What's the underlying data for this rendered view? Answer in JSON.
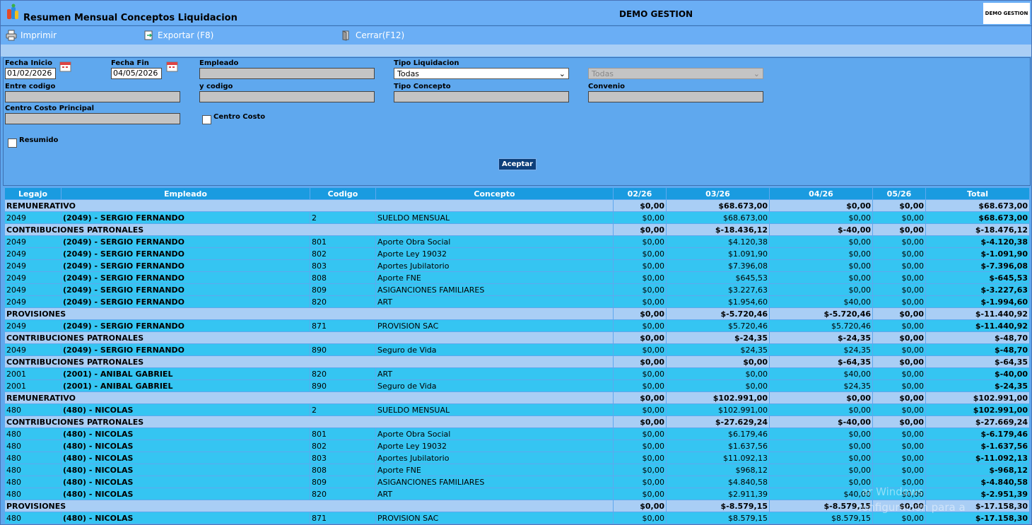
{
  "header": {
    "title": "Resumen Mensual Conceptos Liquidacion",
    "company": "DEMO GESTION",
    "brand_text": "DEMO GESTION"
  },
  "toolbar": {
    "print_label": "Imprimir",
    "export_label": "Exportar (F8)",
    "close_label": "Cerrar(F12)"
  },
  "filters": {
    "fecha_inicio_label": "Fecha Inicio",
    "fecha_inicio_value": "01/02/2026",
    "fecha_fin_label": "Fecha Fin",
    "fecha_fin_value": "04/05/2026",
    "empleado_label": "Empleado",
    "empleado_value": "",
    "tipo_liquidacion_label": "Tipo Liquidacion",
    "tipo_liquidacion_value": "Todas",
    "sub_tipo_value": "Todas",
    "entre_codigo_label": "Entre codigo",
    "y_codigo_label": "y codigo",
    "tipo_concepto_label": "Tipo Concepto",
    "convenio_label": "Convenio",
    "centro_costo_principal_label": "Centro Costo Principal",
    "centro_costo_label": "Centro Costo",
    "resumido_label": "Resumido",
    "accept_label": "Aceptar"
  },
  "table": {
    "headers": [
      "Legajo",
      "Empleado",
      "Codigo",
      "Concepto",
      "02/26",
      "03/26",
      "04/26",
      "05/26",
      "Total"
    ],
    "rows": [
      {
        "type": "group",
        "label": "REMUNERATIVO",
        "vals": [
          "$0,00",
          "$68.673,00",
          "$0,00",
          "$0,00",
          "$68.673,00"
        ]
      },
      {
        "type": "detail",
        "legajo": "2049",
        "empleado": "(2049) - SERGIO FERNANDO",
        "codigo": "2",
        "concepto": "SUELDO MENSUAL",
        "vals": [
          "$0,00",
          "$68.673,00",
          "$0,00",
          "$0,00",
          "$68.673,00"
        ]
      },
      {
        "type": "group",
        "label": "CONTRIBUCIONES PATRONALES",
        "vals": [
          "$0,00",
          "$-18.436,12",
          "$-40,00",
          "$0,00",
          "$-18.476,12"
        ]
      },
      {
        "type": "detail",
        "legajo": "2049",
        "empleado": "(2049) - SERGIO FERNANDO",
        "codigo": "801",
        "concepto": "Aporte Obra Social",
        "vals": [
          "$0,00",
          "$4.120,38",
          "$0,00",
          "$0,00",
          "$-4.120,38"
        ]
      },
      {
        "type": "detail",
        "legajo": "2049",
        "empleado": "(2049) - SERGIO FERNANDO",
        "codigo": "802",
        "concepto": "Aporte Ley 19032",
        "vals": [
          "$0,00",
          "$1.091,90",
          "$0,00",
          "$0,00",
          "$-1.091,90"
        ]
      },
      {
        "type": "detail",
        "legajo": "2049",
        "empleado": "(2049) - SERGIO FERNANDO",
        "codigo": "803",
        "concepto": "Aportes Jubilatorio",
        "vals": [
          "$0,00",
          "$7.396,08",
          "$0,00",
          "$0,00",
          "$-7.396,08"
        ]
      },
      {
        "type": "detail",
        "legajo": "2049",
        "empleado": "(2049) - SERGIO FERNANDO",
        "codigo": "808",
        "concepto": "Aporte FNE",
        "vals": [
          "$0,00",
          "$645,53",
          "$0,00",
          "$0,00",
          "$-645,53"
        ]
      },
      {
        "type": "detail",
        "legajo": "2049",
        "empleado": "(2049) - SERGIO FERNANDO",
        "codigo": "809",
        "concepto": "ASIGANCIONES FAMILIARES",
        "vals": [
          "$0,00",
          "$3.227,63",
          "$0,00",
          "$0,00",
          "$-3.227,63"
        ]
      },
      {
        "type": "detail",
        "legajo": "2049",
        "empleado": "(2049) - SERGIO FERNANDO",
        "codigo": "820",
        "concepto": "ART",
        "vals": [
          "$0,00",
          "$1.954,60",
          "$40,00",
          "$0,00",
          "$-1.994,60"
        ]
      },
      {
        "type": "group",
        "label": "PROVISIONES",
        "vals": [
          "$0,00",
          "$-5.720,46",
          "$-5.720,46",
          "$0,00",
          "$-11.440,92"
        ]
      },
      {
        "type": "detail",
        "legajo": "2049",
        "empleado": "(2049) - SERGIO FERNANDO",
        "codigo": "871",
        "concepto": "PROVISION SAC",
        "vals": [
          "$0,00",
          "$5.720,46",
          "$5.720,46",
          "$0,00",
          "$-11.440,92"
        ]
      },
      {
        "type": "group",
        "label": "CONTRIBUCIONES PATRONALES",
        "vals": [
          "$0,00",
          "$-24,35",
          "$-24,35",
          "$0,00",
          "$-48,70"
        ]
      },
      {
        "type": "detail",
        "legajo": "2049",
        "empleado": "(2049) - SERGIO FERNANDO",
        "codigo": "890",
        "concepto": "Seguro de Vida",
        "vals": [
          "$0,00",
          "$24,35",
          "$24,35",
          "$0,00",
          "$-48,70"
        ]
      },
      {
        "type": "group",
        "label": "CONTRIBUCIONES PATRONALES",
        "vals": [
          "$0,00",
          "$0,00",
          "$-64,35",
          "$0,00",
          "$-64,35"
        ]
      },
      {
        "type": "detail",
        "legajo": "2001",
        "empleado": "(2001) - ANIBAL GABRIEL",
        "codigo": "820",
        "concepto": "ART",
        "vals": [
          "$0,00",
          "$0,00",
          "$40,00",
          "$0,00",
          "$-40,00"
        ]
      },
      {
        "type": "detail",
        "legajo": "2001",
        "empleado": "(2001) - ANIBAL GABRIEL",
        "codigo": "890",
        "concepto": "Seguro de Vida",
        "vals": [
          "$0,00",
          "$0,00",
          "$24,35",
          "$0,00",
          "$-24,35"
        ]
      },
      {
        "type": "group",
        "label": "REMUNERATIVO",
        "vals": [
          "$0,00",
          "$102.991,00",
          "$0,00",
          "$0,00",
          "$102.991,00"
        ]
      },
      {
        "type": "detail",
        "legajo": "480",
        "empleado": "(480) - NICOLAS",
        "codigo": "2",
        "concepto": "SUELDO MENSUAL",
        "vals": [
          "$0,00",
          "$102.991,00",
          "$0,00",
          "$0,00",
          "$102.991,00"
        ]
      },
      {
        "type": "group",
        "label": "CONTRIBUCIONES PATRONALES",
        "vals": [
          "$0,00",
          "$-27.629,24",
          "$-40,00",
          "$0,00",
          "$-27.669,24"
        ]
      },
      {
        "type": "detail",
        "legajo": "480",
        "empleado": "(480) - NICOLAS",
        "codigo": "801",
        "concepto": "Aporte Obra Social",
        "vals": [
          "$0,00",
          "$6.179,46",
          "$0,00",
          "$0,00",
          "$-6.179,46"
        ]
      },
      {
        "type": "detail",
        "legajo": "480",
        "empleado": "(480) - NICOLAS",
        "codigo": "802",
        "concepto": "Aporte Ley 19032",
        "vals": [
          "$0,00",
          "$1.637,56",
          "$0,00",
          "$0,00",
          "$-1.637,56"
        ]
      },
      {
        "type": "detail",
        "legajo": "480",
        "empleado": "(480) - NICOLAS",
        "codigo": "803",
        "concepto": "Aportes Jubilatorio",
        "vals": [
          "$0,00",
          "$11.092,13",
          "$0,00",
          "$0,00",
          "$-11.092,13"
        ]
      },
      {
        "type": "detail",
        "legajo": "480",
        "empleado": "(480) - NICOLAS",
        "codigo": "808",
        "concepto": "Aporte FNE",
        "vals": [
          "$0,00",
          "$968,12",
          "$0,00",
          "$0,00",
          "$-968,12"
        ]
      },
      {
        "type": "detail",
        "legajo": "480",
        "empleado": "(480) - NICOLAS",
        "codigo": "809",
        "concepto": "ASIGANCIONES FAMILIARES",
        "vals": [
          "$0,00",
          "$4.840,58",
          "$0,00",
          "$0,00",
          "$-4.840,58"
        ]
      },
      {
        "type": "detail",
        "legajo": "480",
        "empleado": "(480) - NICOLAS",
        "codigo": "820",
        "concepto": "ART",
        "vals": [
          "$0,00",
          "$2.911,39",
          "$40,00",
          "$0,00",
          "$-2.951,39"
        ]
      },
      {
        "type": "group",
        "label": "PROVISIONES",
        "vals": [
          "$0,00",
          "$-8.579,15",
          "$-8.579,15",
          "$0,00",
          "$-17.158,30"
        ]
      },
      {
        "type": "detail",
        "legajo": "480",
        "empleado": "(480) - NICOLAS",
        "codigo": "871",
        "concepto": "PROVISION SAC",
        "vals": [
          "$0,00",
          "$8.579,15",
          "$8.579,15",
          "$0,00",
          "$-17.158,30"
        ]
      }
    ]
  },
  "watermark": {
    "line1": "ar Windows",
    "line2": "configuración para a"
  }
}
